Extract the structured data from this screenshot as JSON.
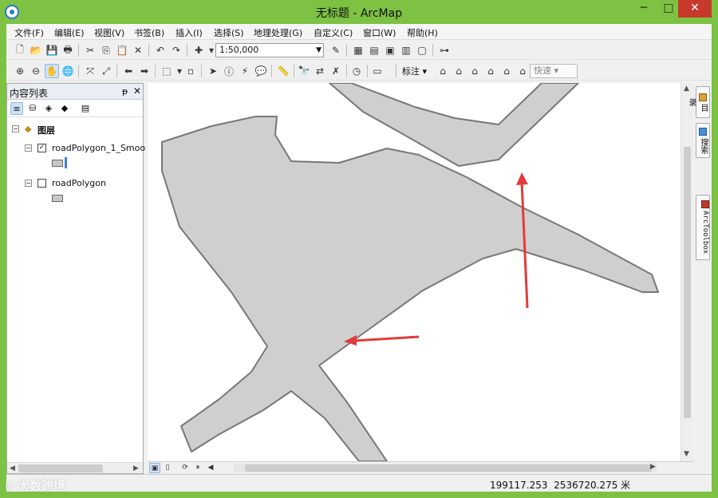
{
  "window": {
    "title": "无标题 - ArcMap",
    "min_label": "─",
    "max_label": "□",
    "close_label": "✕"
  },
  "menu": [
    "文件(F)",
    "编辑(E)",
    "视图(V)",
    "书签(B)",
    "插入(I)",
    "选择(S)",
    "地理处理(G)",
    "自定义(C)",
    "窗口(W)",
    "帮助(H)"
  ],
  "toolbar": {
    "scale_value": "1:50,000",
    "label_button": "标注",
    "speed_placeholder": "快速"
  },
  "toc": {
    "title": "内容列表",
    "pin": "ᵽ",
    "close": "✕",
    "root": "图层",
    "layers": [
      {
        "name": "roadPolygon_1_Smoo",
        "checked": true
      },
      {
        "name": "roadPolygon",
        "checked": false
      }
    ]
  },
  "side_tabs": [
    "目录",
    "搜索",
    "ArcToolbox"
  ],
  "status": {
    "coord_x": "199117.253",
    "coord_y": "2536720.275",
    "unit": "米"
  },
  "watermark": "大数跨境",
  "colors": {
    "frame": "#7dc243",
    "road_fill": "#cfcfcf",
    "road_stroke": "#777777",
    "arrow": "#e23b3b",
    "close_button": "#c7392b"
  },
  "icons": [
    "new-icon",
    "open-icon",
    "save-icon",
    "print-icon",
    "cut-icon",
    "copy-icon",
    "paste-icon",
    "delete-icon",
    "undo-icon",
    "redo-icon",
    "add-data-icon",
    "zoom-in-icon",
    "zoom-out-icon",
    "pan-icon",
    "full-extent-icon",
    "back-icon",
    "forward-icon",
    "select-icon",
    "identify-icon",
    "find-icon",
    "measure-icon"
  ]
}
